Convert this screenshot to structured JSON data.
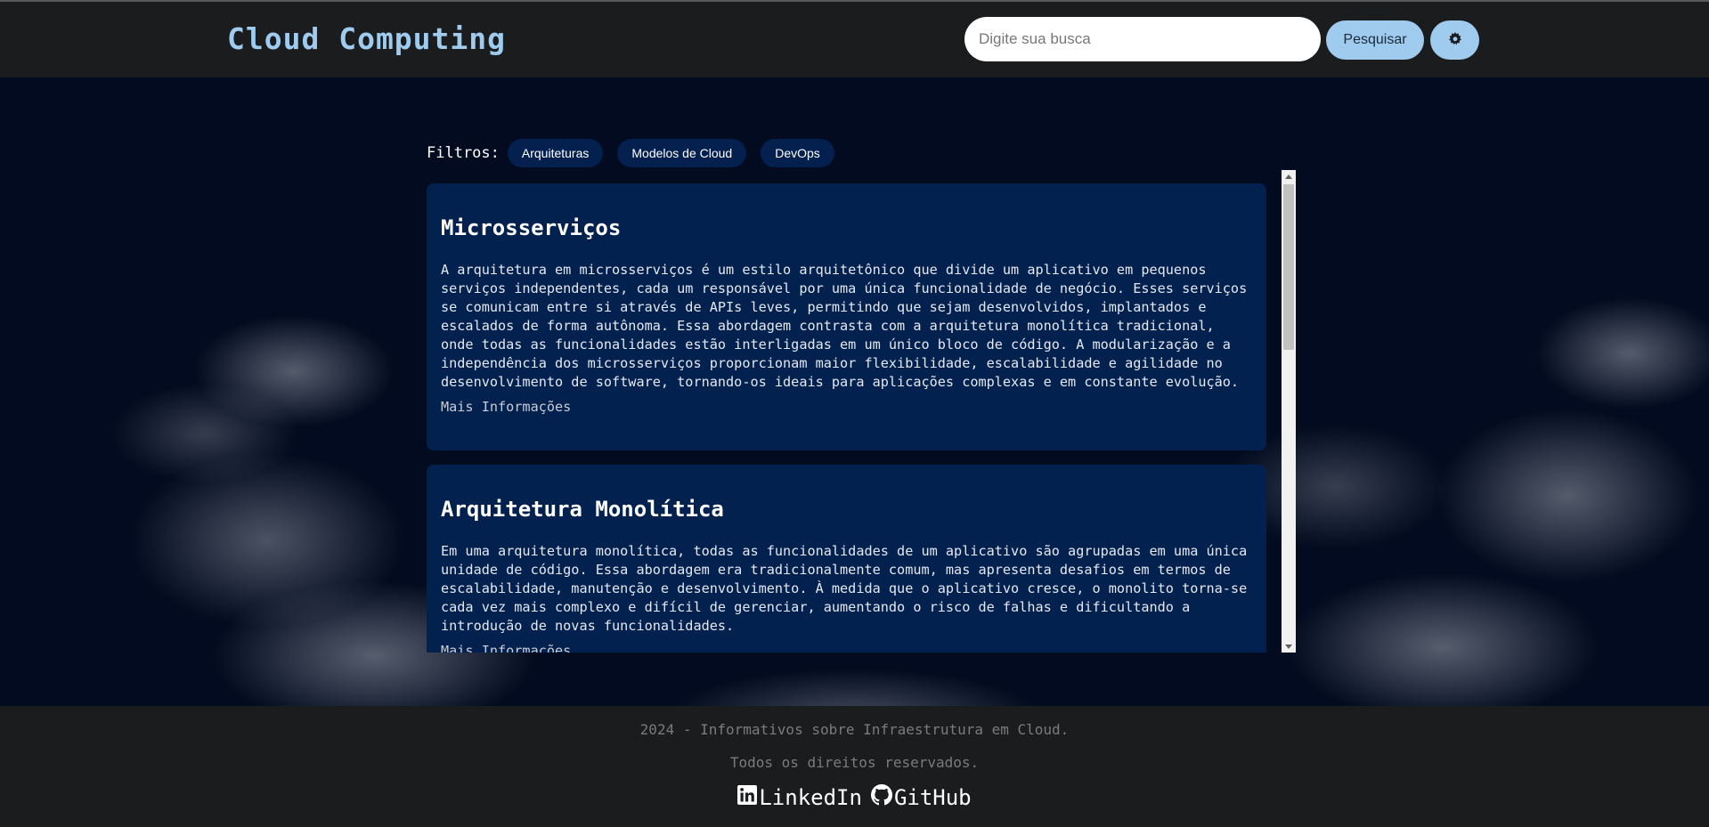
{
  "header": {
    "title": "Cloud Computing",
    "search_placeholder": "Digite sua busca",
    "search_button": "Pesquisar",
    "theme_icon": "gear-icon"
  },
  "filters": {
    "label": "Filtros:",
    "chips": [
      "Arquiteturas",
      "Modelos de Cloud",
      "DevOps"
    ]
  },
  "cards": [
    {
      "title": "Microsserviços",
      "body": "A arquitetura em microsserviços é um estilo arquitetônico que divide um aplicativo em pequenos serviços independentes, cada um responsável por uma única funcionalidade de negócio. Esses serviços se comunicam entre si através de APIs leves, permitindo que sejam desenvolvidos, implantados e escalados de forma autônoma. Essa abordagem contrasta com a arquitetura monolítica tradicional, onde todas as funcionalidades estão interligadas em um único bloco de código. A modularização e a independência dos microsserviços proporcionam maior flexibilidade, escalabilidade e agilidade no desenvolvimento de software, tornando-os ideais para aplicações complexas e em constante evolução.",
      "link": "Mais Informações"
    },
    {
      "title": "Arquitetura Monolítica",
      "body": "Em uma arquitetura monolítica, todas as funcionalidades de um aplicativo são agrupadas em uma única unidade de código. Essa abordagem era tradicionalmente comum, mas apresenta desafios em termos de escalabilidade, manutenção e desenvolvimento. À medida que o aplicativo cresce, o monolito torna-se cada vez mais complexo e difícil de gerenciar, aumentando o risco de falhas e dificultando a introdução de novas funcionalidades.",
      "link": "Mais Informações"
    }
  ],
  "footer": {
    "line1": "2024 - Informativos sobre Infraestrutura em Cloud.",
    "line2": "Todos os direitos reservados.",
    "links": [
      {
        "label": "LinkedIn",
        "icon": "linkedin-icon"
      },
      {
        "label": "GitHub",
        "icon": "github-icon"
      }
    ]
  }
}
